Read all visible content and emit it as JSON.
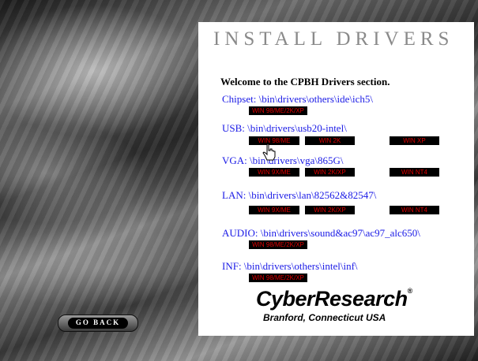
{
  "title": "INSTALL DRIVERS",
  "welcome": "Welcome to the CPBH Drivers section.",
  "drivers": [
    {
      "label": "Chipset: \\bin\\drivers\\others\\ide\\ich5\\",
      "buttons": [
        "WIN 98/ME/2K/XP"
      ]
    },
    {
      "label": "USB: \\bin\\drivers\\usb20-intel\\",
      "buttons": [
        "WIN 98/ME",
        "WIN 2K",
        "WIN XP"
      ]
    },
    {
      "label": "VGA: \\bin\\drivers\\vga\\865G\\",
      "buttons": [
        "WIN 9X/ME",
        "WIN 2K/XP",
        "WIN NT4"
      ]
    },
    {
      "label": "LAN: \\bin\\drivers\\lan\\82562&82547\\",
      "buttons": [
        "WIN 9X/ME",
        "WIN 2K/XP",
        "WIN NT4"
      ]
    },
    {
      "label": "AUDIO: \\bin\\drivers\\sound&ac97\\ac97_alc650\\",
      "buttons": [
        "WIN 98/ME/2K/XP"
      ]
    },
    {
      "label": "INF: \\bin\\drivers\\others\\intel\\inf\\",
      "buttons": [
        "WIN 98/ME/2K/XP"
      ]
    }
  ],
  "logo": {
    "name": "CyberResearch",
    "registered": "®",
    "tagline": "Branford, Connecticut  USA"
  },
  "go_back": "GO BACK",
  "colors": {
    "link": "#1a1ae6",
    "button_bg": "#000000",
    "button_text": "#e00000",
    "title": "#8a8a8a"
  },
  "icons": {
    "cursor": "hand-pointer-icon"
  }
}
